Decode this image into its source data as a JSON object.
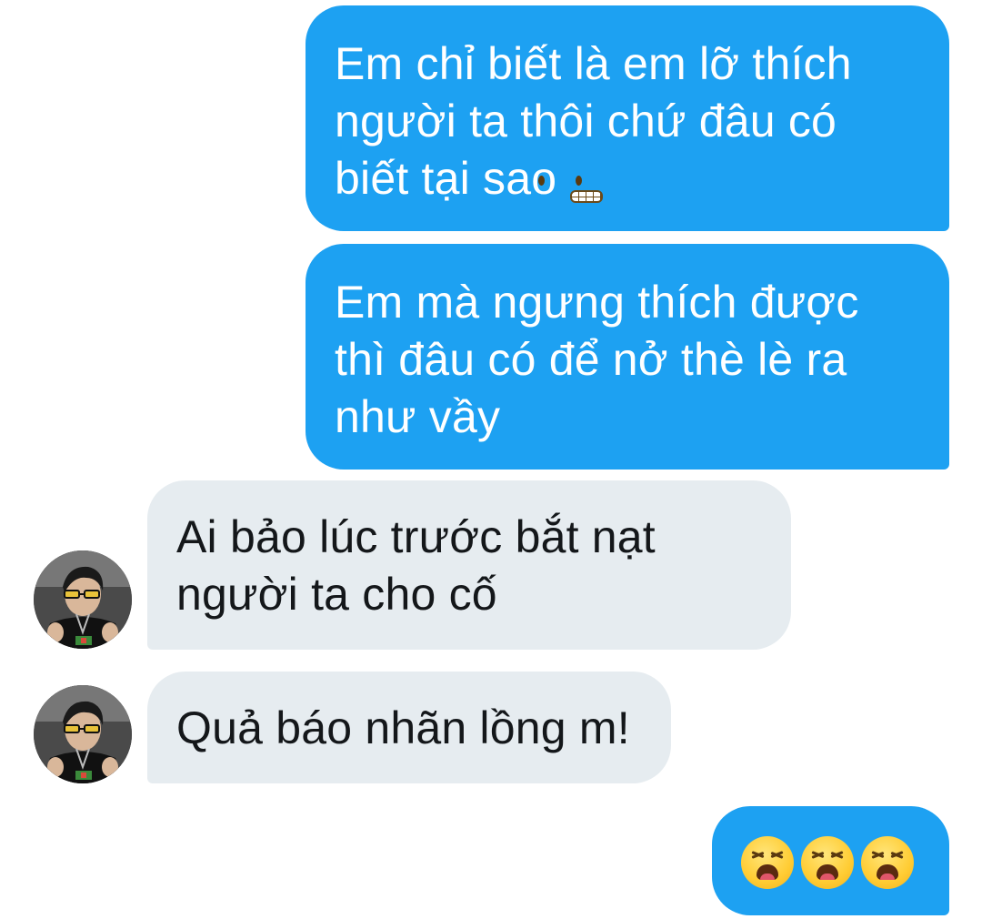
{
  "conversation": {
    "messages": [
      {
        "sender": "me",
        "lines": [
          "Em chỉ biết là em lỡ thích",
          "người ta thôi chứ đâu có",
          "biết tại sao"
        ],
        "trailing_emoji": "grimacing-face"
      },
      {
        "sender": "me",
        "lines": [
          "Em mà ngưng thích được",
          "thì đâu có để nở thè lè ra",
          "như vầy"
        ]
      },
      {
        "sender": "them",
        "lines": [
          "Ai bảo lúc trước bắt nạt",
          "người ta cho cố"
        ]
      },
      {
        "sender": "them",
        "lines": [
          "Quả báo nhãn lồng m!"
        ]
      },
      {
        "sender": "me",
        "emojis": [
          "tired-face",
          "tired-face",
          "tired-face"
        ]
      }
    ]
  },
  "colors": {
    "outgoing_bubble": "#1DA1F2",
    "outgoing_text": "#FFFFFF",
    "incoming_bubble": "#E6ECF0",
    "incoming_text": "#14171A"
  }
}
